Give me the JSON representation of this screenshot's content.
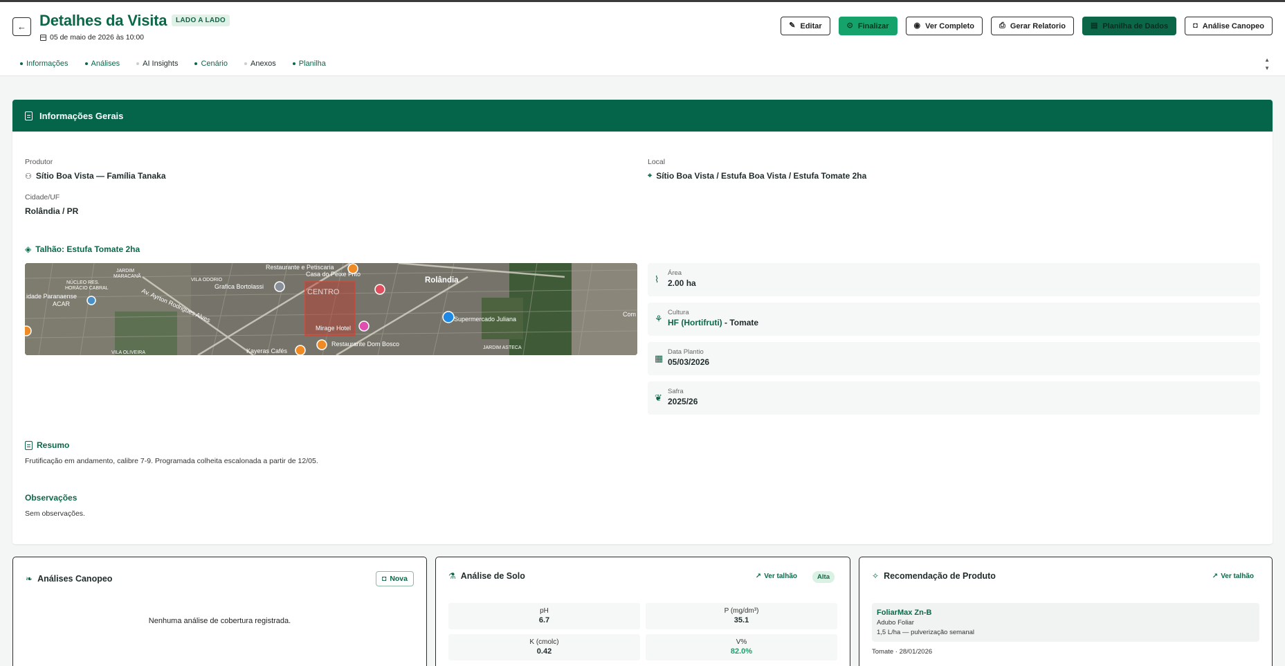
{
  "header": {
    "title": "Detalhes da Visita",
    "mode_badge": "LADO A LADO",
    "datetime": "05 de maio de 2026 às 10:00",
    "actions": {
      "editar": "Editar",
      "finalizar": "Finalizar",
      "ver_completo": "Ver Completo",
      "gerar_relatorio": "Gerar Relatorio",
      "planilha_dados": "Planilha de Dados",
      "analise_canopeo": "Análise Canopeo"
    }
  },
  "tabs": [
    {
      "label": "Informações"
    },
    {
      "label": "Análises"
    },
    {
      "label": "AI Insights"
    },
    {
      "label": "Cenário"
    },
    {
      "label": "Anexos"
    },
    {
      "label": "Planilha"
    }
  ],
  "info": {
    "card_title": "Informações Gerais",
    "produtor_label": "Produtor",
    "produtor_value": "Sítio Boa Vista — Família Tanaka",
    "local_label": "Local",
    "local_value": "Sítio Boa Vista / Estufa Boa Vista / Estufa Tomate 2ha",
    "cidade_label": "Cidade/UF",
    "cidade_value": "Rolândia / PR",
    "talhao_title": "Talhão: Estufa Tomate 2ha",
    "stats": {
      "area_label": "Área",
      "area_value": "2.00 ha",
      "cultura_label": "Cultura",
      "cultura_hl": "HF (Hortifruti)",
      "cultura_rest": " - Tomate",
      "plantio_label": "Data Plantio",
      "plantio_value": "05/03/2026",
      "safra_label": "Safra",
      "safra_value": "2025/26"
    },
    "resumo_title": "Resumo",
    "resumo_text": "Frutificação em andamento, calibre 7-9. Programada colheita escalonada a partir de 12/05.",
    "obs_title": "Observações",
    "obs_text": "Sem observações."
  },
  "map": {
    "labels": {
      "centro": "CENTRO",
      "rolandia": "Rolândia",
      "restaurante": "Restaurante e Petiscaria",
      "casa_peixe": "Casa do Peixe Frito",
      "grafica": "Grafica Bortolassi",
      "vila_odorio": "VILA ODORIO",
      "nucleo": "NÚCLEO RES.",
      "horacio": "HORÁCIO CABRAL",
      "jardim": "JARDIM",
      "maracana": "MARACANÃ",
      "cidade_par": "idade Paranaense",
      "acar": "ACAR",
      "av_ayrton": "Av. Ayrton Rodrigues Alves",
      "mirage": "Mirage Hotel",
      "rest_dom": "Restaurante Dom Bosco",
      "kayeras": "Kayeras Cafés",
      "supermercado": "Supermercado Juliana",
      "jardim_asteca": "JARDIM ASTECA",
      "vila_oliveira": "VILA OLIVEIRA",
      "com": "Com"
    }
  },
  "canopeo": {
    "title": "Análises Canopeo",
    "nova_label": "Nova",
    "empty": "Nenhuma análise de cobertura registrada."
  },
  "solo": {
    "title": "Análise de Solo",
    "ver_talhao": "Ver talhão",
    "badge": "Alta",
    "items": [
      {
        "label": "pH",
        "value": "6.7"
      },
      {
        "label": "P (mg/dm³)",
        "value": "35.1"
      },
      {
        "label": "K (cmolc)",
        "value": "0.42"
      },
      {
        "label": "V%",
        "value": "82.0%"
      }
    ]
  },
  "recomendacao": {
    "title": "Recomendação de Produto",
    "ver_talhao": "Ver talhão",
    "product_name": "FoliarMax Zn-B",
    "product_type": "Adubo Foliar",
    "product_dose": "1,5 L/ha — pulverização semanal",
    "footer": "Tomate · 28/01/2026"
  },
  "colors": {
    "brand_green": "#0b6748",
    "accent_green": "#16a36b",
    "header_bar": "#04654a"
  }
}
